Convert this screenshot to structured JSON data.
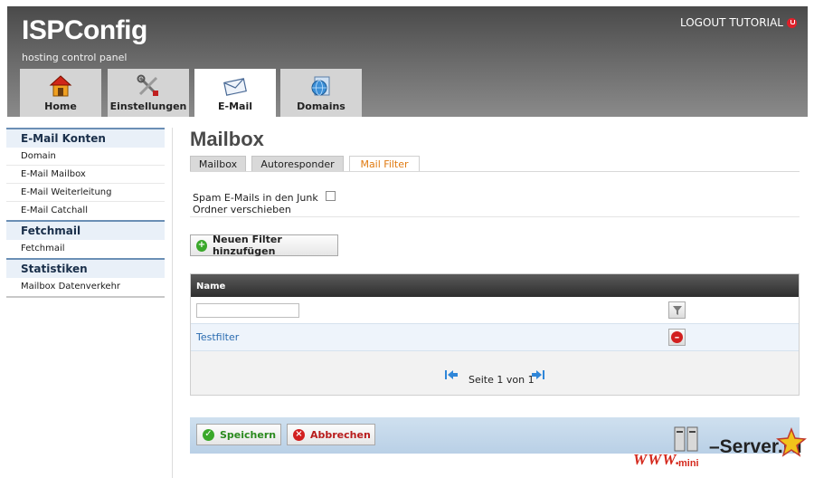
{
  "app": {
    "logo": "ISPConfig",
    "subtitle": "hosting control panel",
    "logout_label": "LOGOUT TUTORIAL"
  },
  "top_tabs": [
    {
      "label": "Home",
      "icon": "home-icon"
    },
    {
      "label": "Einstellungen",
      "icon": "tools-icon"
    },
    {
      "label": "E-Mail",
      "icon": "envelope-icon",
      "active": true
    },
    {
      "label": "Domains",
      "icon": "globe-icon"
    }
  ],
  "sidebar": {
    "sections": [
      {
        "title": "E-Mail Konten",
        "items": [
          "Domain",
          "E-Mail Mailbox",
          "E-Mail Weiterleitung",
          "E-Mail Catchall"
        ]
      },
      {
        "title": "Fetchmail",
        "items": [
          "Fetchmail"
        ]
      },
      {
        "title": "Statistiken",
        "items": [
          "Mailbox Datenverkehr"
        ]
      }
    ]
  },
  "main": {
    "title": "Mailbox",
    "tabs": [
      {
        "label": "Mailbox"
      },
      {
        "label": "Autoresponder"
      },
      {
        "label": "Mail Filter",
        "active": true
      }
    ],
    "spam_label": "Spam E-Mails in den Junk Ordner verschieben",
    "spam_checked": false,
    "add_filter_label": "Neuen Filter hinzufügen",
    "table": {
      "column_name": "Name",
      "filter_value": "",
      "rows": [
        {
          "name": "Testfilter"
        }
      ],
      "pager_text": "Seite 1 von 1"
    },
    "save_label": "Speichern",
    "cancel_label": "Abbrechen"
  },
  "watermark": {
    "www": "WWW.",
    "mini": "mini",
    "server": "–Server.ru"
  },
  "colors": {
    "accent_orange": "#e07a10",
    "link_blue": "#2b6cb0",
    "save_green": "#2a8a1e",
    "cancel_red": "#b81c1c"
  }
}
